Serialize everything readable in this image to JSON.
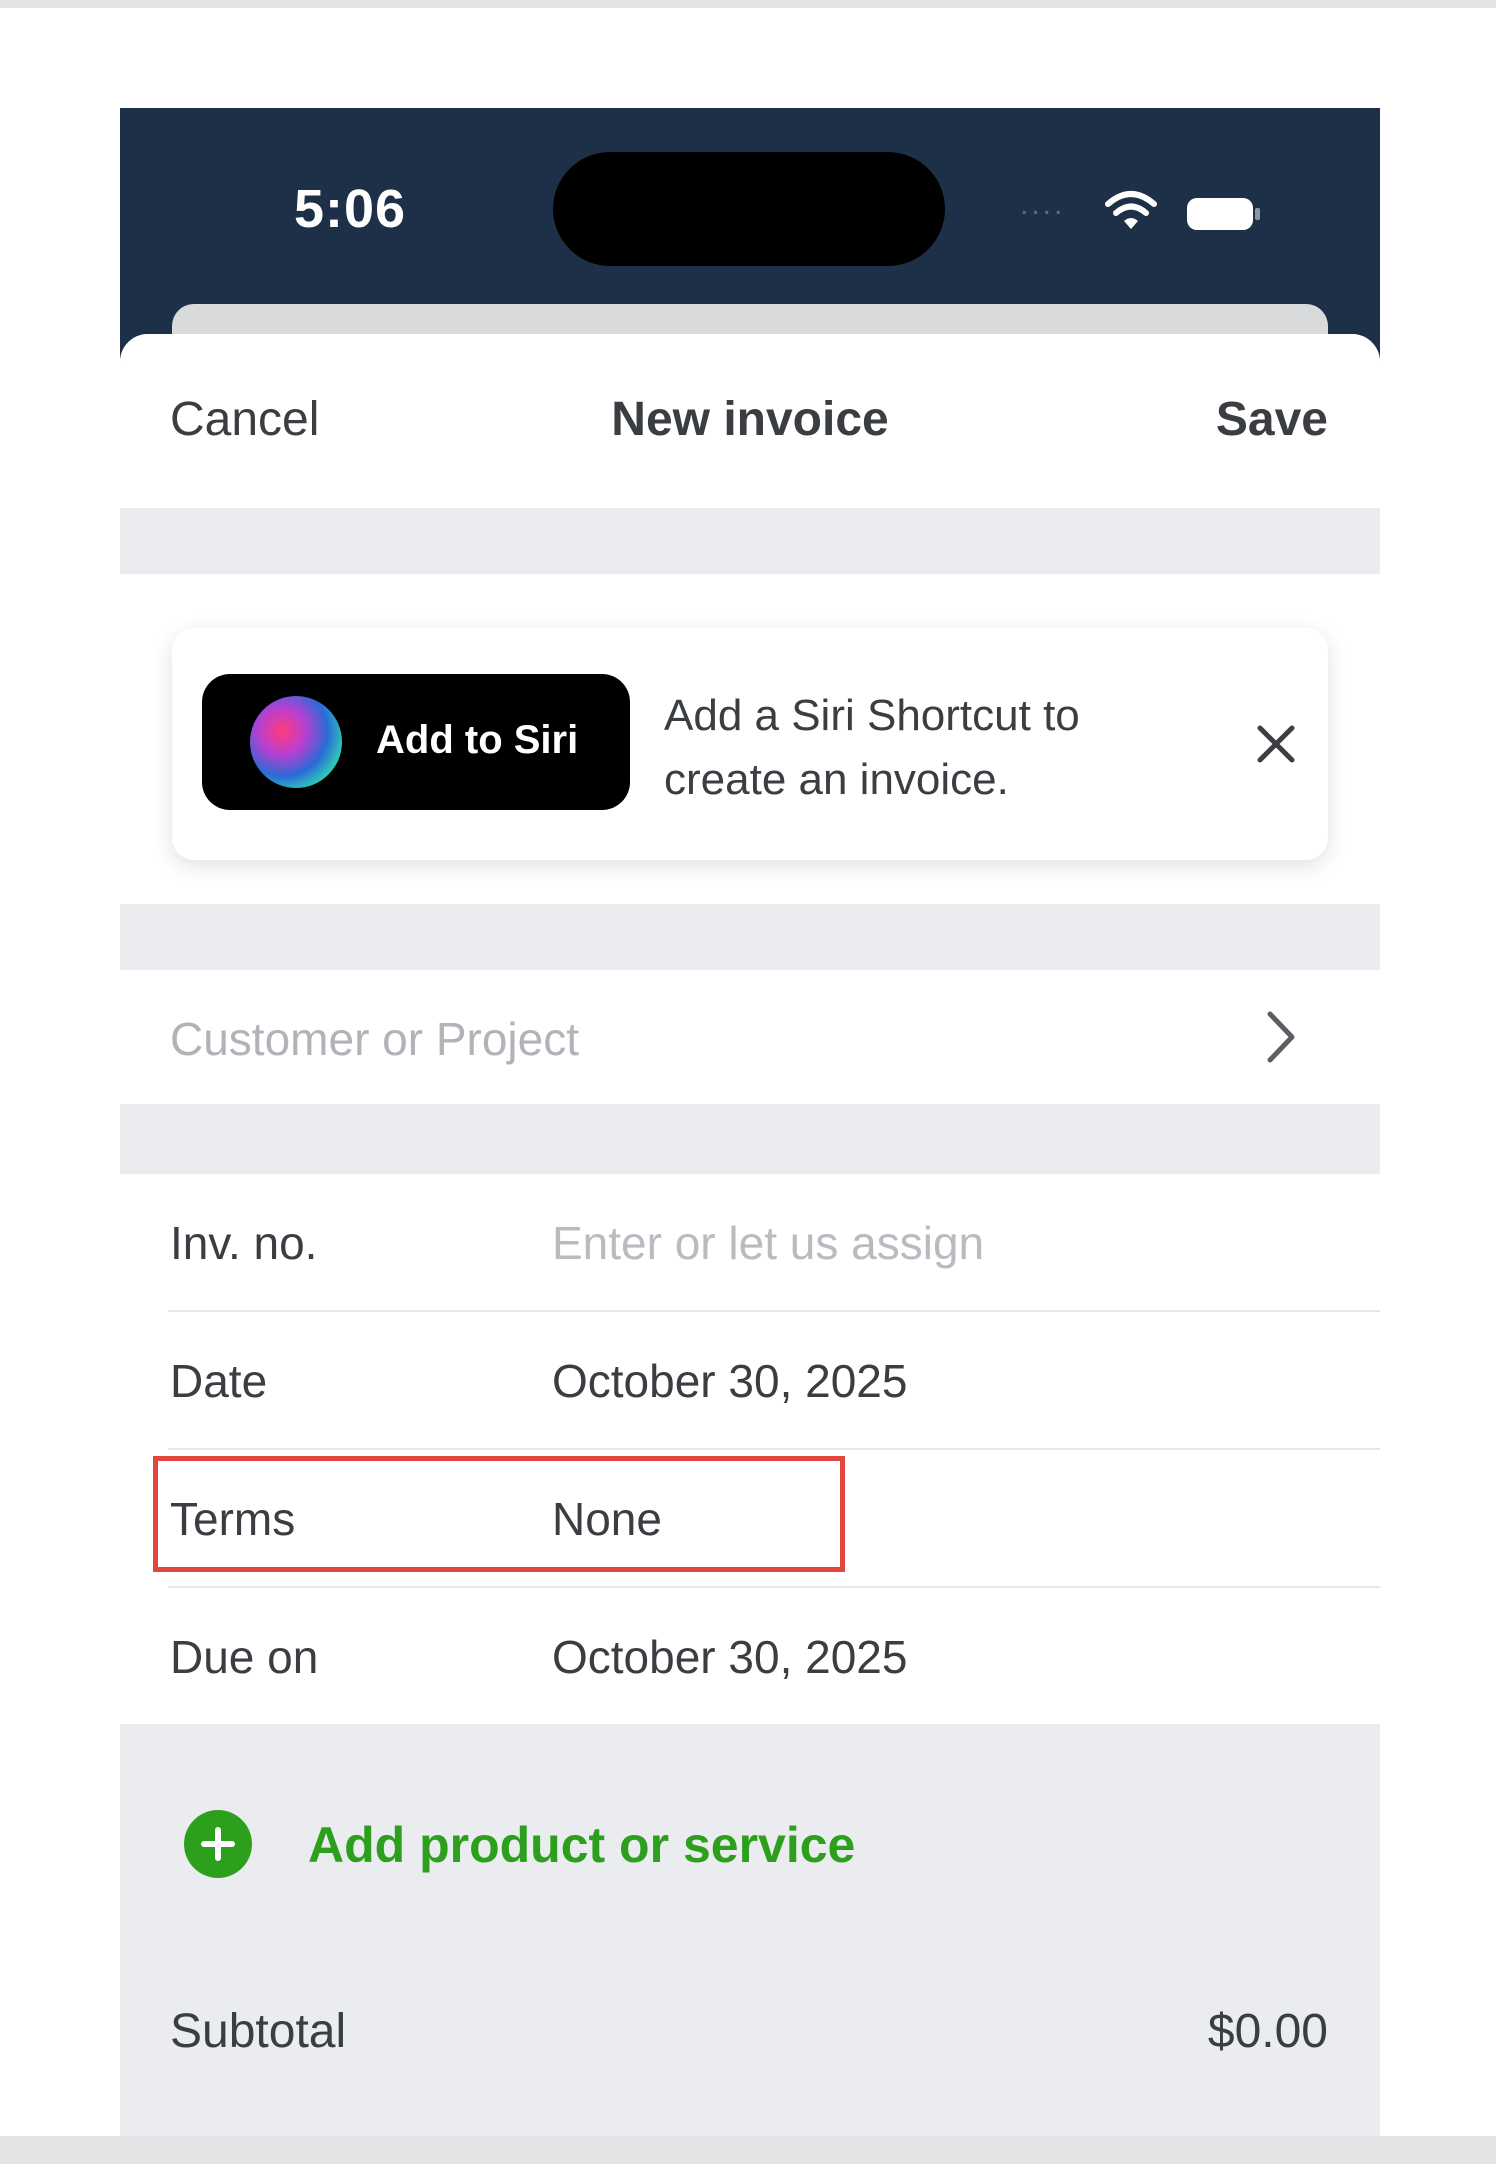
{
  "status_bar": {
    "time": "5:06",
    "signal": "....",
    "icons": [
      "wifi-icon",
      "battery-icon"
    ]
  },
  "nav": {
    "cancel_label": "Cancel",
    "title": "New invoice",
    "save_label": "Save"
  },
  "siri": {
    "button_label": "Add to Siri",
    "message": "Add a Siri Shortcut to create an invoice.",
    "close_icon": "close-icon"
  },
  "customer": {
    "placeholder": "Customer or Project",
    "icon": "chevron-right-icon"
  },
  "form": {
    "invoice_number": {
      "label": "Inv. no.",
      "placeholder": "Enter or let us assign"
    },
    "date": {
      "label": "Date",
      "value": "October 30, 2025"
    },
    "terms": {
      "label": "Terms",
      "value": "None"
    },
    "due_on": {
      "label": "Due on",
      "value": "October 30, 2025"
    }
  },
  "line_items": {
    "add_label": "Add product or service",
    "icon": "plus-circle-icon"
  },
  "totals": {
    "subtotal_label": "Subtotal",
    "subtotal_value": "$0.00"
  },
  "colors": {
    "header_navy": "#1d3048",
    "accent_green": "#2ca01c",
    "highlight_red": "#e2463d",
    "section_gray": "#ebecef"
  }
}
